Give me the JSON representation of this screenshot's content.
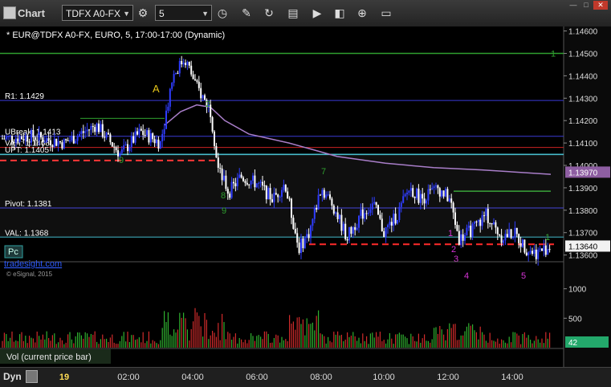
{
  "app": {
    "title": "Chart"
  },
  "toolbar": {
    "symbol": "TDFX A0-FX",
    "interval": "5",
    "icons": [
      "settings-icon",
      "clock-icon",
      "pencil-icon",
      "refresh-icon",
      "study-icon",
      "play-icon",
      "toolbox-icon",
      "comment-icon"
    ]
  },
  "chart_data": {
    "type": "candlestick",
    "title": "* EUR@TDFX A0-FX, EURO, 5, 17:00-17:00 (Dynamic)",
    "watermark": "tradesight.com",
    "copyright": "© eSignal, 2015",
    "x_ticks": [
      "19",
      "02:00",
      "04:00",
      "06:00",
      "08:00",
      "10:00",
      "12:00",
      "14:00"
    ],
    "y_ticks": [
      "1.14600",
      "1.14500",
      "1.14400",
      "1.14300",
      "1.14200",
      "1.14100",
      "1.14000",
      "1.13900",
      "1.13800",
      "1.13700",
      "1.13600"
    ],
    "ylim": [
      1.1357,
      1.1462
    ],
    "levels": [
      {
        "label": "R1: 1.1429",
        "value": 1.1429,
        "color": "#3b3bd6",
        "style": "solid"
      },
      {
        "label": "UBreak: 1.1413",
        "value": 1.1413,
        "color": "#3b3bd6",
        "style": "solid"
      },
      {
        "label": "VAH: 1.1408",
        "value": 1.1408,
        "color": "#cc2222",
        "style": "solid"
      },
      {
        "label": "UPT: 1.1405",
        "value": 1.1405,
        "color": "#3fb8c9",
        "style": "solid"
      },
      {
        "label": "Pivot: 1.1381",
        "value": 1.1381,
        "color": "#3b3bd6",
        "style": "solid"
      },
      {
        "label": "VAL: 1.1368",
        "value": 1.1368,
        "color": "#3fb8c9",
        "style": "solid"
      }
    ],
    "price_labels": [
      {
        "text": "1.13970",
        "value": 1.1397,
        "bg": "#8e5ea2",
        "fg": "#ffffff"
      },
      {
        "text": "1.13640",
        "value": 1.1364,
        "bg": "#f2f2f2",
        "fg": "#000000"
      }
    ],
    "annotations": [
      {
        "text": "A",
        "color": "#e6c619"
      },
      {
        "text": "1",
        "color": "#3aa33a"
      },
      {
        "text": "1",
        "color": "#d633d6"
      },
      {
        "text": "2",
        "color": "#d633d6"
      },
      {
        "text": "3",
        "color": "#d633d6"
      },
      {
        "text": "4",
        "color": "#d633d6"
      },
      {
        "text": "5",
        "color": "#d633d6"
      },
      {
        "text": "2",
        "color": "#2f9e2f"
      },
      {
        "text": "7",
        "color": "#2f9e2f"
      },
      {
        "text": "8",
        "color": "#2f9e2f"
      },
      {
        "text": "9",
        "color": "#2f9e2f"
      },
      {
        "text": "9",
        "color": "#2f9e2f"
      }
    ],
    "pc_label": "Pc",
    "volume": {
      "label": "Vol (current price bar)",
      "y_ticks": [
        "1000",
        "500"
      ],
      "ylim": [
        0,
        1200
      ],
      "current": "42"
    },
    "colors": {
      "up": "#2f3dff",
      "down": "#ffffff",
      "ma": "#a97ec9",
      "green": "#2fa02f",
      "red": "#ff2b2b"
    }
  },
  "bottom": {
    "dyn_label": "Dyn"
  }
}
